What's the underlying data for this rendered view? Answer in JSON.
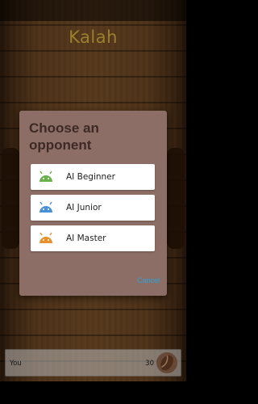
{
  "app": {
    "title": "Kalah"
  },
  "dialog": {
    "title": "Choose an opponent",
    "options": [
      {
        "label": "AI Beginner",
        "icon": "android-icon",
        "color": "#6ab04c"
      },
      {
        "label": "AI Junior",
        "icon": "android-icon",
        "color": "#4a90d9"
      },
      {
        "label": "AI Master",
        "icon": "android-icon",
        "color": "#e8902a"
      }
    ],
    "cancel_label": "Cancel"
  },
  "player": {
    "name": "You",
    "score": "30",
    "avatar": "coffee-bean-icon"
  },
  "colors": {
    "title": "#d6b13e",
    "dialog_bg": "#8c6e66",
    "cancel": "#2aa4d8"
  }
}
